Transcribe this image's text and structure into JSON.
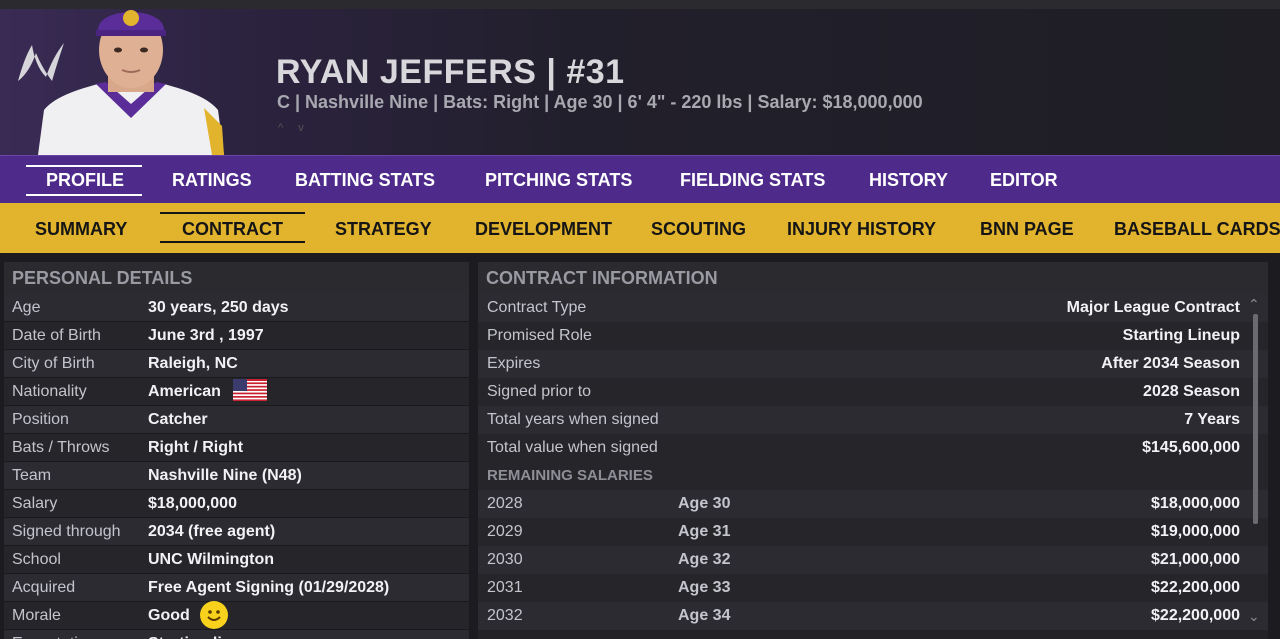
{
  "player": {
    "name_line": "RYAN JEFFERS  |  #31",
    "meta_line": "C | Nashville Nine  |  Bats: Right  |  Age 30  |  6' 4\"  - 220 lbs  |  Salary: $18,000,000",
    "arrows": "^ v",
    "logo_letter": "N"
  },
  "tabs_primary": [
    {
      "label": "PROFILE",
      "active": true
    },
    {
      "label": "RATINGS"
    },
    {
      "label": "BATTING STATS"
    },
    {
      "label": "PITCHING STATS"
    },
    {
      "label": "FIELDING STATS"
    },
    {
      "label": "HISTORY"
    },
    {
      "label": "EDITOR"
    }
  ],
  "tabs_secondary": [
    {
      "label": "SUMMARY"
    },
    {
      "label": "CONTRACT",
      "active": true
    },
    {
      "label": "STRATEGY"
    },
    {
      "label": "DEVELOPMENT"
    },
    {
      "label": "SCOUTING"
    },
    {
      "label": "INJURY HISTORY"
    },
    {
      "label": "BNN PAGE"
    },
    {
      "label": "BASEBALL CARDS"
    }
  ],
  "personal": {
    "title": "PERSONAL DETAILS",
    "rows": [
      {
        "label": "Age",
        "value": "30 years, 250 days"
      },
      {
        "label": "Date of Birth",
        "value": "June 3rd , 1997"
      },
      {
        "label": "City of Birth",
        "value": "Raleigh, NC"
      },
      {
        "label": "Nationality",
        "value": "American"
      },
      {
        "label": "Position",
        "value": "Catcher"
      },
      {
        "label": "Bats / Throws",
        "value": "Right / Right"
      },
      {
        "label": "Team",
        "value": "Nashville Nine (N48)"
      },
      {
        "label": "Salary",
        "value": "$18,000,000"
      },
      {
        "label": "Signed through",
        "value": "2034 (free agent)"
      },
      {
        "label": "School",
        "value": "UNC Wilmington"
      },
      {
        "label": "Acquired",
        "value": "Free Agent Signing (01/29/2028)"
      },
      {
        "label": "Morale",
        "value": "Good"
      },
      {
        "label": "Expectations",
        "value": "Starting lineup"
      }
    ]
  },
  "contract": {
    "title": "CONTRACT INFORMATION",
    "rows": [
      {
        "label": "Contract Type",
        "value": "Major League Contract"
      },
      {
        "label": "Promised Role",
        "value": "Starting Lineup"
      },
      {
        "label": "Expires",
        "value": "After 2034 Season"
      },
      {
        "label": "Signed prior to",
        "value": "2028 Season"
      },
      {
        "label": "Total years when signed",
        "value": "7 Years"
      },
      {
        "label": "Total value when signed",
        "value": "$145,600,000"
      }
    ],
    "remaining_title": "REMAINING SALARIES",
    "remaining": [
      {
        "year": "2028",
        "age": "Age 30",
        "salary": "$18,000,000"
      },
      {
        "year": "2029",
        "age": "Age 31",
        "salary": "$19,000,000"
      },
      {
        "year": "2030",
        "age": "Age 32",
        "salary": "$21,000,000"
      },
      {
        "year": "2031",
        "age": "Age 33",
        "salary": "$22,200,000"
      },
      {
        "year": "2032",
        "age": "Age 34",
        "salary": "$22,200,000"
      }
    ]
  },
  "colors": {
    "primary_tab_bg": "#4e2a8a",
    "secondary_tab_bg": "#e2b42e",
    "panel_bg": "#222227"
  }
}
